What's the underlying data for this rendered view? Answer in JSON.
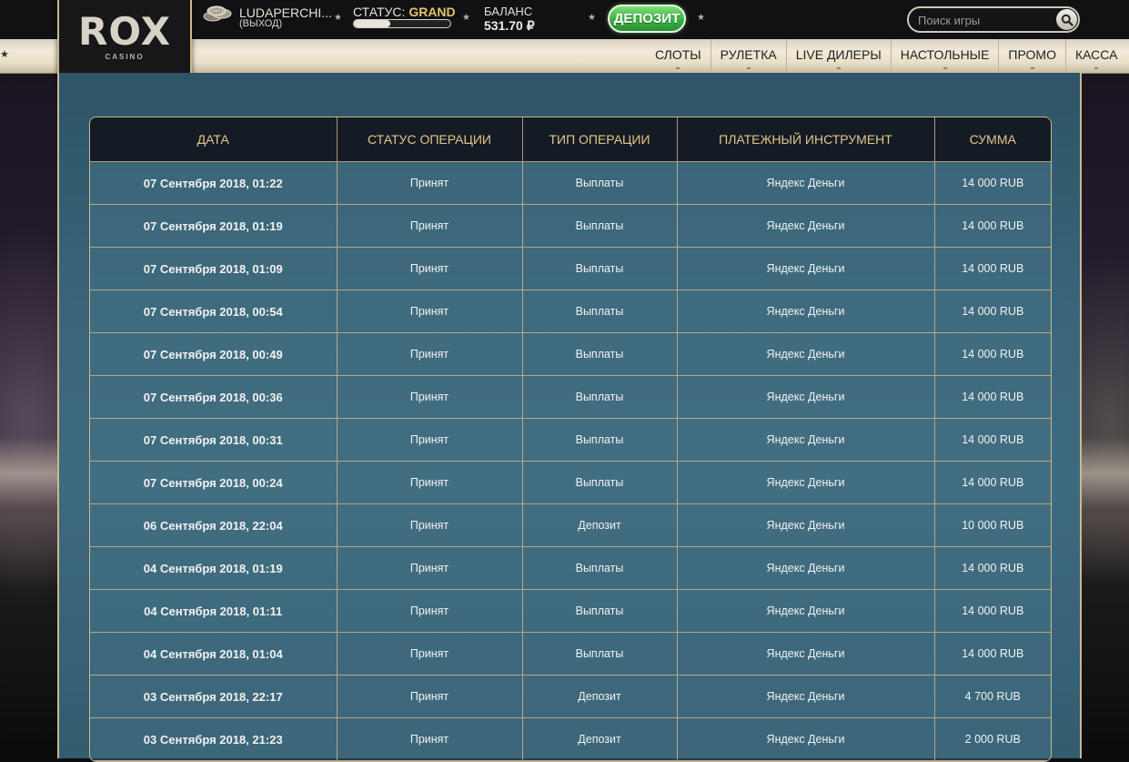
{
  "brand": {
    "logo_main": "ROX",
    "logo_sub": "CASINO"
  },
  "user": {
    "name": "LUDAPERCHI...",
    "logout_label": "(ВЫХОД)"
  },
  "status": {
    "label": "СТАТУС:",
    "value": "GRAND",
    "progress_fraction": 0.38
  },
  "balance": {
    "label": "БАЛАНС",
    "value": "531.70 ₽"
  },
  "deposit_button": {
    "label": "ДЕПОЗИТ"
  },
  "search": {
    "placeholder": "Поиск игры",
    "value": ""
  },
  "nav": {
    "items": [
      "СЛОТЫ",
      "РУЛЕТКА",
      "LIVE ДИЛЕРЫ",
      "НАСТОЛЬНЫЕ",
      "ПРОМО",
      "КАССА"
    ]
  },
  "table": {
    "headers": [
      "ДАТА",
      "СТАТУС ОПЕРАЦИИ",
      "ТИП ОПЕРАЦИИ",
      "ПЛАТЕЖНЫЙ ИНСТРУМЕНТ",
      "СУММА"
    ],
    "rows": [
      [
        "07 Сентября 2018, 01:22",
        "Принят",
        "Выплаты",
        "Яндекс Деньги",
        "14 000 RUB"
      ],
      [
        "07 Сентября 2018, 01:19",
        "Принят",
        "Выплаты",
        "Яндекс Деньги",
        "14 000 RUB"
      ],
      [
        "07 Сентября 2018, 01:09",
        "Принят",
        "Выплаты",
        "Яндекс Деньги",
        "14 000 RUB"
      ],
      [
        "07 Сентября 2018, 00:54",
        "Принят",
        "Выплаты",
        "Яндекс Деньги",
        "14 000 RUB"
      ],
      [
        "07 Сентября 2018, 00:49",
        "Принят",
        "Выплаты",
        "Яндекс Деньги",
        "14 000 RUB"
      ],
      [
        "07 Сентября 2018, 00:36",
        "Принят",
        "Выплаты",
        "Яндекс Деньги",
        "14 000 RUB"
      ],
      [
        "07 Сентября 2018, 00:31",
        "Принят",
        "Выплаты",
        "Яндекс Деньги",
        "14 000 RUB"
      ],
      [
        "07 Сентября 2018, 00:24",
        "Принят",
        "Выплаты",
        "Яндекс Деньги",
        "14 000 RUB"
      ],
      [
        "06 Сентября 2018, 22:04",
        "Принят",
        "Депозит",
        "Яндекс Деньги",
        "10 000 RUB"
      ],
      [
        "04 Сентября 2018, 01:19",
        "Принят",
        "Выплаты",
        "Яндекс Деньги",
        "14 000 RUB"
      ],
      [
        "04 Сентября 2018, 01:11",
        "Принят",
        "Выплаты",
        "Яндекс Деньги",
        "14 000 RUB"
      ],
      [
        "04 Сентября 2018, 01:04",
        "Принят",
        "Выплаты",
        "Яндекс Деньги",
        "14 000 RUB"
      ],
      [
        "03 Сентября 2018, 22:17",
        "Принят",
        "Депозит",
        "Яндекс Деньги",
        "4 700 RUB"
      ],
      [
        "03 Сентября 2018, 21:23",
        "Принят",
        "Депозит",
        "Яндекс Деньги",
        "2 000 RUB"
      ]
    ]
  },
  "colors": {
    "accent_gold": "#e1c68a",
    "status_gold": "#e5c46a",
    "deposit_green": "#3bb043",
    "panel_teal": "#3a6578"
  },
  "icons": {
    "chips": "chips-icon",
    "search": "search-icon",
    "star": "star-icon"
  }
}
